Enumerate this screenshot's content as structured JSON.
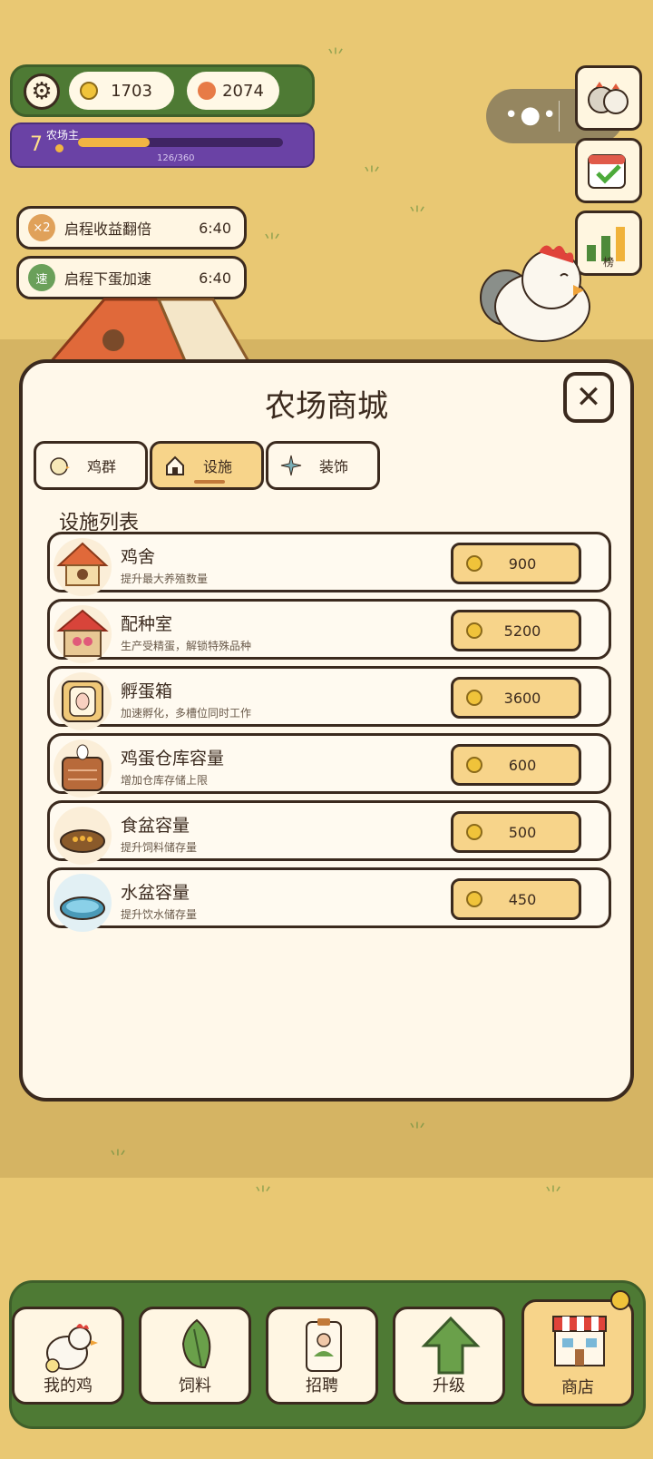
{
  "resources": {
    "coins": "1703",
    "gems": "2074"
  },
  "level": {
    "number": "7",
    "title": "农场主",
    "xp_text": "126/360",
    "progress": 0.35
  },
  "side_buttons": {
    "rank_label": "榜"
  },
  "buffs": [
    {
      "icon_text": "×2",
      "label": "启程收益翻倍",
      "time": "6:40",
      "color": "#e0a15a"
    },
    {
      "icon_text": "速",
      "label": "启程下蛋加速",
      "time": "6:40",
      "color": "#6aa05a"
    }
  ],
  "modal": {
    "title": "农场商城",
    "tabs": [
      {
        "label": "鸡群",
        "icon": "chick-icon"
      },
      {
        "label": "设施",
        "icon": "house-icon"
      },
      {
        "label": "装饰",
        "icon": "sparkle-icon"
      }
    ],
    "active_tab": "设施",
    "section": "设施列表",
    "items": [
      {
        "name": "鸡舍",
        "desc": "提升最大养殖数量",
        "price": "900",
        "icon": "coop-icon"
      },
      {
        "name": "配种室",
        "desc": "生产受精蛋，解锁特殊品种",
        "price": "5200",
        "icon": "breeding-room-icon"
      },
      {
        "name": "孵蛋箱",
        "desc": "加速孵化，多槽位同时工作",
        "price": "3600",
        "icon": "incubator-icon"
      },
      {
        "name": "鸡蛋仓库容量",
        "desc": "增加仓库存储上限",
        "price": "600",
        "icon": "egg-warehouse-icon"
      },
      {
        "name": "食盆容量",
        "desc": "提升饲料储存量",
        "price": "500",
        "icon": "food-bowl-icon"
      },
      {
        "name": "水盆容量",
        "desc": "提升饮水储存量",
        "price": "450",
        "icon": "water-bowl-icon"
      }
    ]
  },
  "nav": [
    {
      "label": "我的鸡",
      "icon": "chicken-icon"
    },
    {
      "label": "饲料",
      "icon": "leaf-icon"
    },
    {
      "label": "招聘",
      "icon": "badge-icon"
    },
    {
      "label": "升级",
      "icon": "up-arrow-icon"
    },
    {
      "label": "商店",
      "icon": "store-icon"
    }
  ],
  "active_nav": "商店"
}
